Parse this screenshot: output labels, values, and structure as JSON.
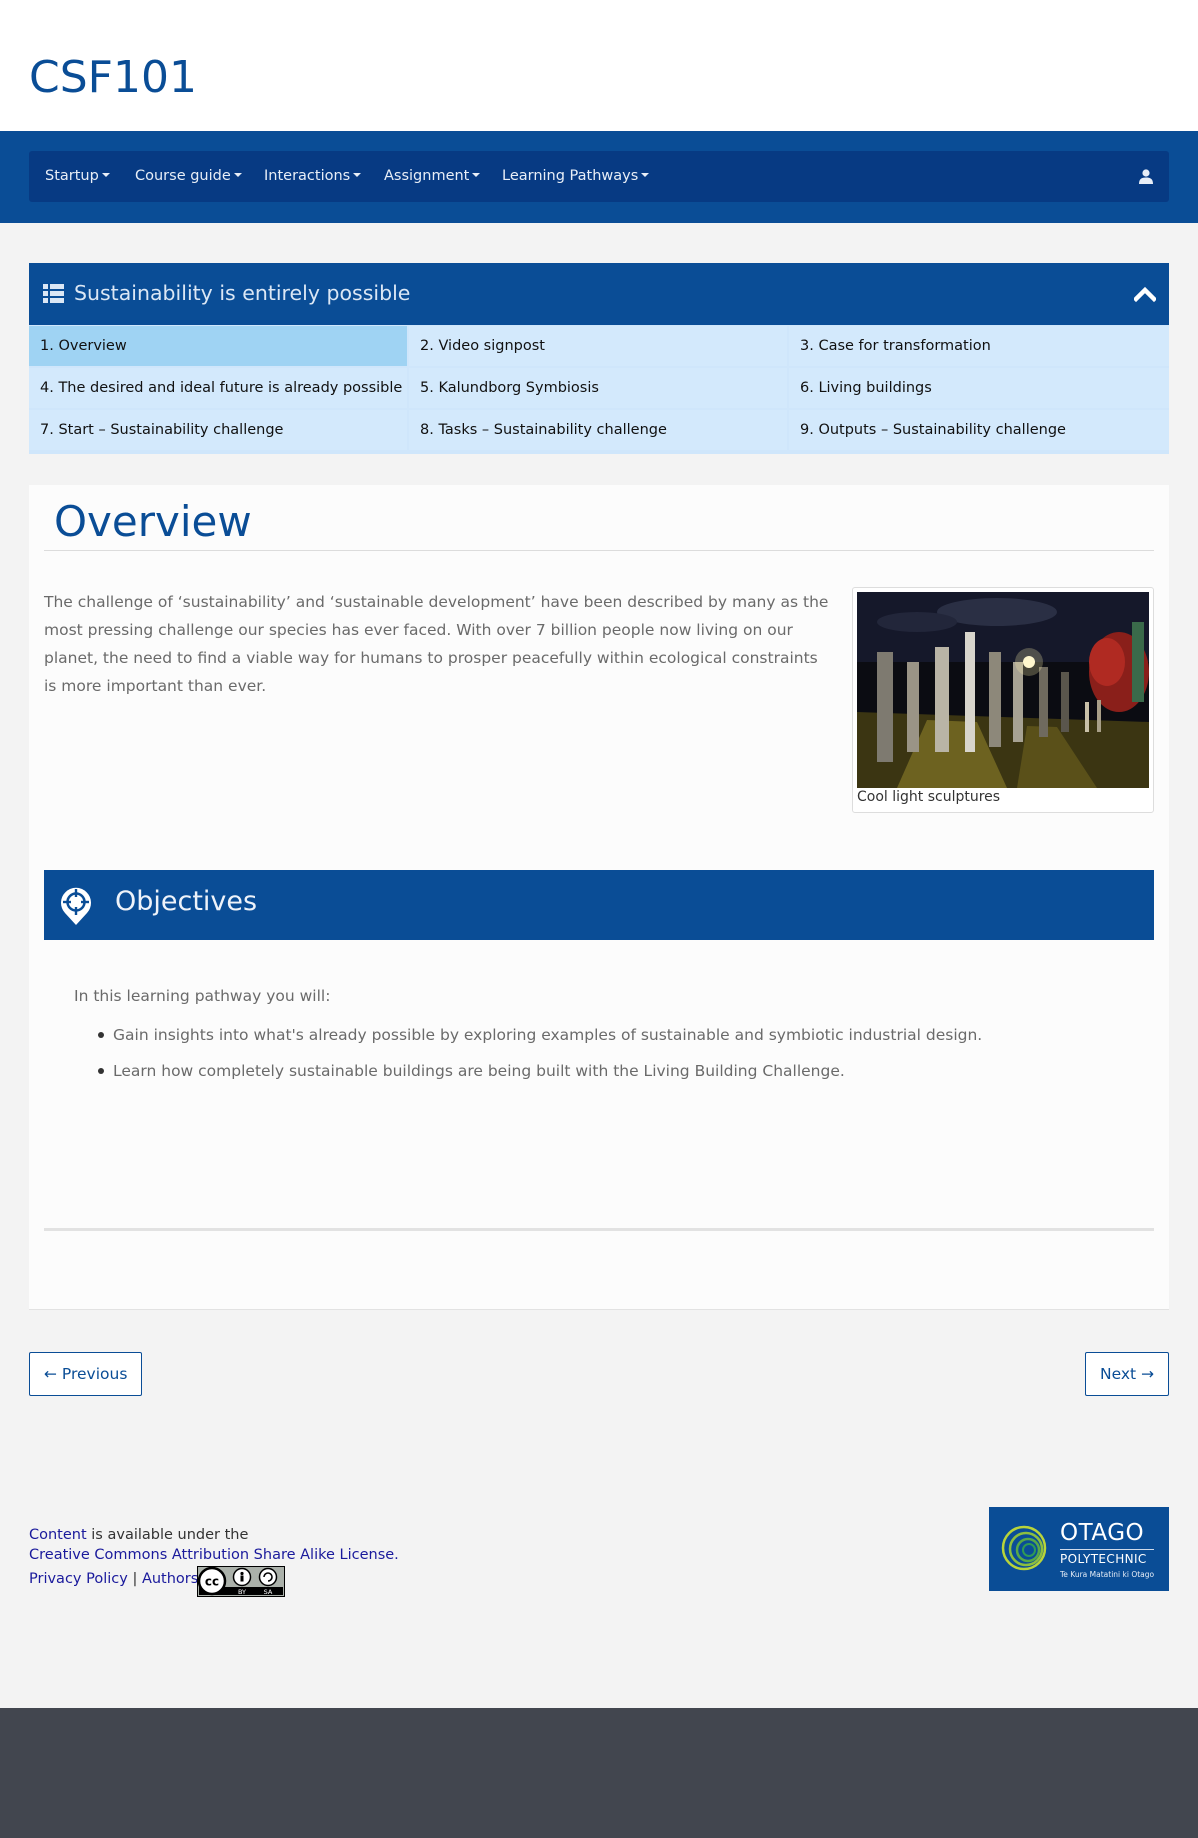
{
  "site": {
    "title": "CSF101"
  },
  "nav": {
    "items": [
      {
        "label": "Startup"
      },
      {
        "label": "Course guide"
      },
      {
        "label": "Interactions"
      },
      {
        "label": "Assignment"
      },
      {
        "label": "Learning Pathways"
      }
    ],
    "user_icon": "user-icon"
  },
  "pathway": {
    "title": "Sustainability is entirely possible",
    "items": [
      {
        "label": "1. Overview",
        "active": true
      },
      {
        "label": "2. Video signpost"
      },
      {
        "label": "3. Case for transformation"
      },
      {
        "label": "4. The desired and ideal future is already possible"
      },
      {
        "label": "5. Kalundborg Symbiosis"
      },
      {
        "label": "6. Living buildings"
      },
      {
        "label": "7. Start – Sustainability challenge"
      },
      {
        "label": "8. Tasks – Sustainability challenge"
      },
      {
        "label": "9. Outputs – Sustainability challenge"
      }
    ]
  },
  "main": {
    "heading": "Overview",
    "intro": "The challenge of ‘sustainability’ and ‘sustainable development’ have been described by many as the most pressing challenge our species has ever faced. With over 7 billion people now living on our planet, the need to find a viable way for humans to prosper peacefully within ecological constraints is more important than ever.",
    "figure": {
      "caption": "Cool light sculptures"
    },
    "objectives": {
      "title": "Objectives",
      "intro": "In this learning pathway you will:",
      "items": [
        "Gain insights into what's already possible by exploring examples of sustainable and symbiotic industrial design.",
        "Learn how completely sustainable buildings are being built with the Living Building Challenge."
      ]
    }
  },
  "pager": {
    "previous": "← Previous",
    "next": "Next →"
  },
  "footer": {
    "content_link": "Content",
    "available": " is available under the",
    "license": "Creative Commons Attribution Share Alike License.",
    "privacy": "Privacy Policy",
    "sep": "|",
    "authors": "Authors",
    "cc_badge": {
      "cc": "cc",
      "by": "BY",
      "sa": "SA"
    },
    "logo": {
      "name": "OTAGO",
      "sub": "POLYTECHNIC",
      "tag": "Te Kura Matatini ki Otago"
    }
  },
  "colors": {
    "brand": "#0a4d96",
    "nav_dark": "#073a83",
    "cell": "#d3e9fc",
    "cell_active": "#9fd3f3",
    "footer_dark": "#42464f"
  }
}
